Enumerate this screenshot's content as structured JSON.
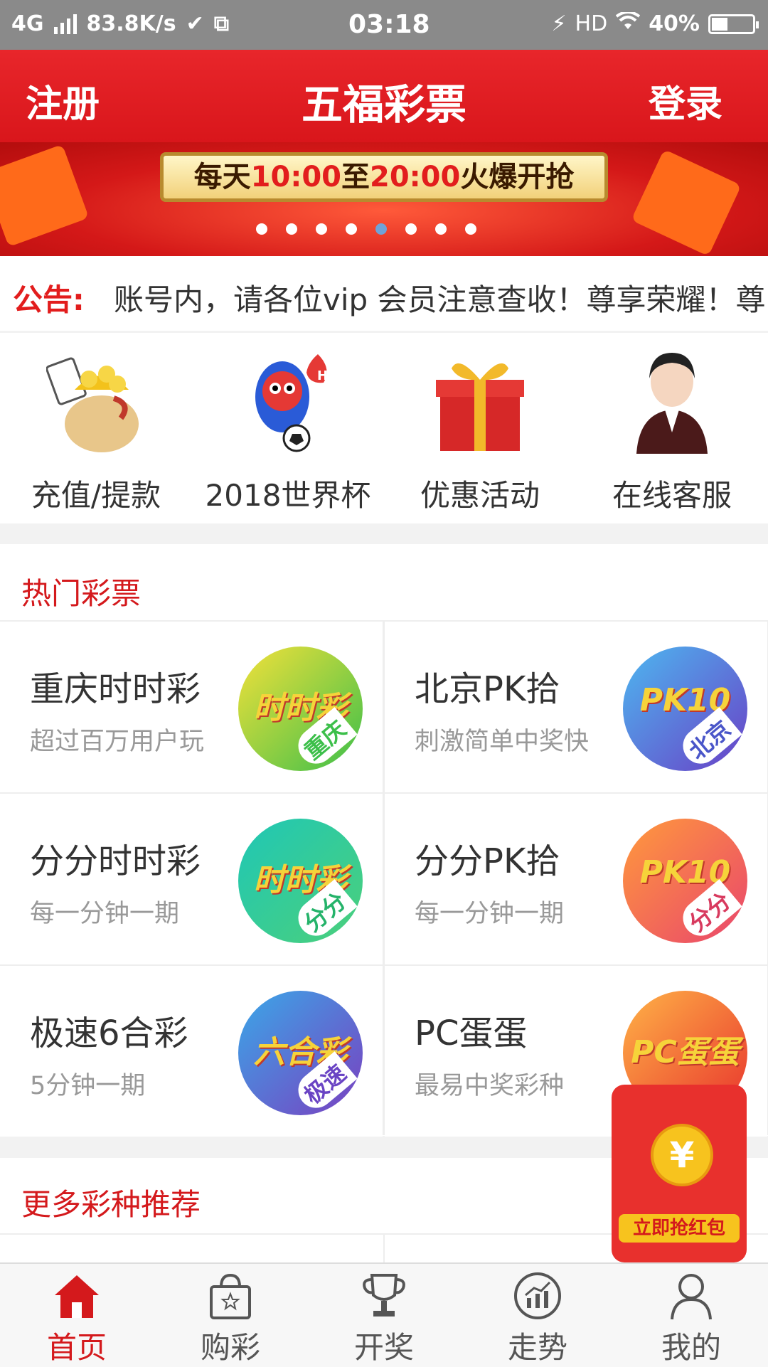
{
  "status_bar": {
    "network": "4G",
    "speed": "83.8K/s",
    "time": "03:18",
    "hd": "HD",
    "battery": "40%",
    "battery_level": 0.4
  },
  "header": {
    "register_label": "注册",
    "title": "五福彩票",
    "login_label": "登录",
    "color": "#e21d1d"
  },
  "banner": {
    "headline_prefix": "每天",
    "start_time": "10:00",
    "middle": "至",
    "end_time": "20:00",
    "headline_suffix": "火爆开抢",
    "dots_total": 8,
    "active_dot": 5
  },
  "notice": {
    "label": "公告:",
    "text": "账号内，请各位vip 会员注意查收！尊享荣耀！尊"
  },
  "quick_links": [
    {
      "label": "充值/提款",
      "icon": "money-bag-icon"
    },
    {
      "label": "2018世界杯",
      "icon": "world-cup-mascot-icon",
      "badge": "HOT"
    },
    {
      "label": "优惠活动",
      "icon": "gift-box-icon"
    },
    {
      "label": "在线客服",
      "icon": "customer-service-icon"
    }
  ],
  "hot_lottery": {
    "heading": "热门彩票",
    "items": [
      {
        "name": "重庆时时彩",
        "desc": "超过百万用户玩",
        "logo_text": "时时彩",
        "badge": "重庆",
        "colors": [
          "#f4e13a",
          "#3cbf4a"
        ],
        "badge_color": "#3cbf4a"
      },
      {
        "name": "北京PK拾",
        "desc": "刺激简单中奖快",
        "logo_text": "PK10",
        "badge": "北京",
        "colors": [
          "#4db8f0",
          "#6a3fc6"
        ],
        "badge_color": "#4a56c9"
      },
      {
        "name": "分分时时彩",
        "desc": "每一分钟一期",
        "logo_text": "时时彩",
        "badge": "分分",
        "colors": [
          "#1fc7b6",
          "#4cd07a"
        ],
        "badge_color": "#25b36a"
      },
      {
        "name": "分分PK拾",
        "desc": "每一分钟一期",
        "logo_text": "PK10",
        "badge": "分分",
        "colors": [
          "#ff9a3c",
          "#e9456d"
        ],
        "badge_color": "#d83a5e"
      },
      {
        "name": "极速6合彩",
        "desc": "5分钟一期",
        "logo_text": "六合彩",
        "badge": "极速",
        "colors": [
          "#3aa8e8",
          "#7a3fc0"
        ],
        "badge_color": "#6a44c4"
      },
      {
        "name": "PC蛋蛋",
        "desc": "最易中奖彩种",
        "logo_text": "PC蛋蛋",
        "badge": "",
        "colors": [
          "#ffb347",
          "#e8342d"
        ],
        "badge_color": "#e8342d"
      }
    ]
  },
  "more_lottery": {
    "heading": "更多彩种推荐"
  },
  "red_packet": {
    "coin_symbol": "¥",
    "button_label": "立即抢红包"
  },
  "tab_bar": {
    "active_index": 0,
    "items": [
      {
        "label": "首页",
        "icon": "home-icon"
      },
      {
        "label": "购彩",
        "icon": "shopping-bag-icon"
      },
      {
        "label": "开奖",
        "icon": "trophy-icon"
      },
      {
        "label": "走势",
        "icon": "trend-chart-icon"
      },
      {
        "label": "我的",
        "icon": "user-icon"
      }
    ]
  }
}
